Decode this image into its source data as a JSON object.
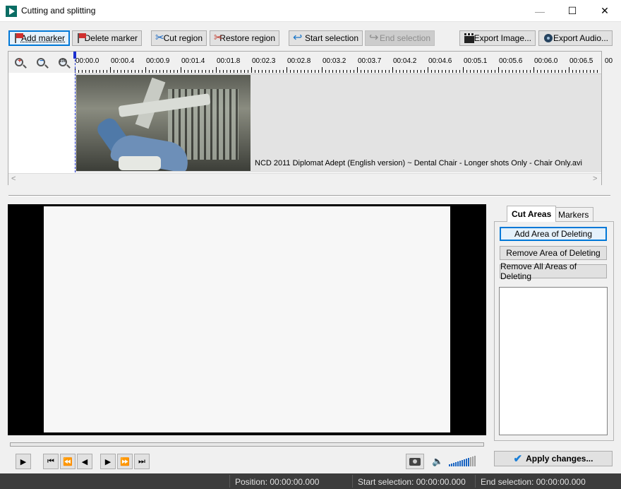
{
  "window": {
    "title": "Cutting and splitting",
    "icon": "app-video-icon",
    "controls": {
      "minimize": "—",
      "maximize": "☐",
      "close": "✕"
    }
  },
  "toolbar": {
    "add_marker": "Add marker",
    "delete_marker": "Delete marker",
    "cut_region": "Cut region",
    "restore_region": "Restore region",
    "start_selection": "Start selection",
    "end_selection": "End selection",
    "export_image": "Export Image...",
    "export_audio": "Export Audio..."
  },
  "timeline": {
    "zoom_labels": {
      "zoom_in": "+",
      "zoom_out": "−",
      "zoom_fit": "100"
    },
    "ticks": [
      "00:00.0",
      "00:00.4",
      "00:00.9",
      "00:01.4",
      "00:01.8",
      "00:02.3",
      "00:02.8",
      "00:03.2",
      "00:03.7",
      "00:04.2",
      "00:04.6",
      "00:05.1",
      "00:05.6",
      "00:06.0",
      "00:06.5",
      "00"
    ],
    "clip_filename": "NCD 2011 Diplomat Adept (English version) ~ Dental Chair - Longer shots Only - Chair Only.avi",
    "scroll_left": "<",
    "scroll_right": ">"
  },
  "tabs": {
    "cut_areas": "Cut Areas",
    "markers": "Markers"
  },
  "cut_areas_panel": {
    "add_area": "Add Area of Deleting",
    "remove_area": "Remove Area of Deleting",
    "remove_all": "Remove All Areas of Deleting"
  },
  "playback": {
    "play": "▶",
    "first": "⏮",
    "rewind": "⏪",
    "step_back": "◀",
    "step_forward": "▶",
    "fast_forward": "⏩",
    "last": "⏭",
    "speaker": "🔈"
  },
  "apply": {
    "label": "Apply changes..."
  },
  "status": {
    "position": "Position: 00:00:00.000",
    "start_selection": "Start selection: 00:00:00.000",
    "end_selection": "End selection: 00:00:00.000"
  },
  "colors": {
    "accent": "#0078d7",
    "statusbar_bg": "#3c3c3c",
    "playhead": "#1a2fd0"
  }
}
